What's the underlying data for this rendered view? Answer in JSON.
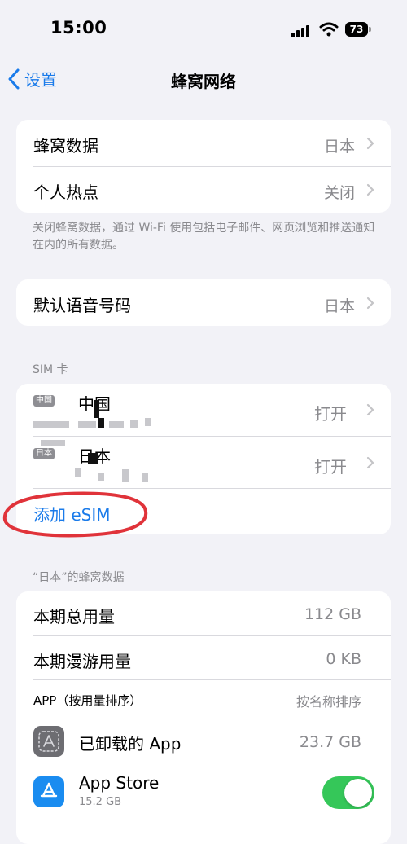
{
  "status": {
    "time": "15:00",
    "battery": "73"
  },
  "nav": {
    "back_label": "设置",
    "title": "蜂窝网络"
  },
  "group1": {
    "rows": [
      {
        "label": "蜂窝数据",
        "value": "日本"
      },
      {
        "label": "个人热点",
        "value": "关闭"
      }
    ],
    "footer": "关闭蜂窝数据，通过 Wi-Fi 使用包括电子邮件、网页浏览和推送通知在内的所有数据。"
  },
  "group2": {
    "rows": [
      {
        "label": "默认语音号码",
        "value": "日本"
      }
    ]
  },
  "sim": {
    "header": "SIM 卡",
    "items": [
      {
        "tag": "中国",
        "name": "中国",
        "value": "打开"
      },
      {
        "tag": "日本",
        "name": "日本",
        "value": "打开"
      }
    ],
    "add_esim": "添加 eSIM"
  },
  "usage": {
    "header": "“日本”的蜂窝数据",
    "rows": [
      {
        "label": "本期总用量",
        "value": "112 GB"
      },
      {
        "label": "本期漫游用量",
        "value": "0 KB"
      }
    ],
    "apps_header": "APP（按用量排序）",
    "sort_link": "按名称排序",
    "apps": [
      {
        "name": "已卸载的 App",
        "value": "23.7 GB",
        "icon": "uninstalled-apps-icon"
      },
      {
        "name": "App Store",
        "sub": "15.2 GB",
        "icon": "app-store-icon",
        "toggle": true
      }
    ]
  },
  "colors": {
    "accent": "#1a7bea",
    "toggle_on": "#35c759",
    "annotation": "#e0333a"
  }
}
